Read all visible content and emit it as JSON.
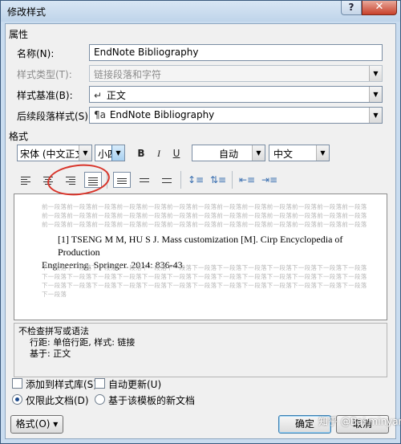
{
  "window": {
    "title": "修改样式",
    "help": "?",
    "close": "✕"
  },
  "properties": {
    "group_label": "属性",
    "name_label": "名称(N):",
    "name_value": "EndNote Bibliography",
    "type_label": "样式类型(T):",
    "type_value": "链接段落和字符",
    "base_label": "样式基准(B):",
    "base_value": "正文",
    "next_label": "后续段落样式(S):",
    "next_value": "EndNote Bibliography"
  },
  "format": {
    "group_label": "格式",
    "font_value": "宋体 (中文正文)",
    "size_value": "小四",
    "bold": "B",
    "italic": "I",
    "underline": "U",
    "color_value": "自动",
    "lang_value": "中文"
  },
  "preview": {
    "ghost_before": "前一段落前一段落前一段落前一段落前一段落前一段落前一段落前一段落前一段落前一段落前一段落前一段落前一段落",
    "sample_line1": "[1]  TSENG M M, HU S J. Mass customization [M]. Cirp Encyclopedia of Production",
    "sample_line2": "Engineering. Springer. 2014: 836-43.",
    "ghost_after": "下一段落下一段落下一段落下一段落下一段落下一段落下一段落下一段落下一段落下一段落下一段落下一段落下一段落",
    "ghost_after_short": "下一段落"
  },
  "description": {
    "line1": "不检查拼写或语法",
    "line2": "行距: 单倍行距, 样式: 链接",
    "line3": "基于: 正文"
  },
  "options": {
    "add_to_gallery": "添加到样式库(S)",
    "auto_update": "自动更新(U)",
    "this_document": "仅限此文档(D)",
    "new_template": "基于该模板的新文档"
  },
  "buttons": {
    "format": "格式(O) ▾",
    "ok": "确定",
    "cancel": "取消"
  },
  "watermark": "知乎 @Bai minyang"
}
